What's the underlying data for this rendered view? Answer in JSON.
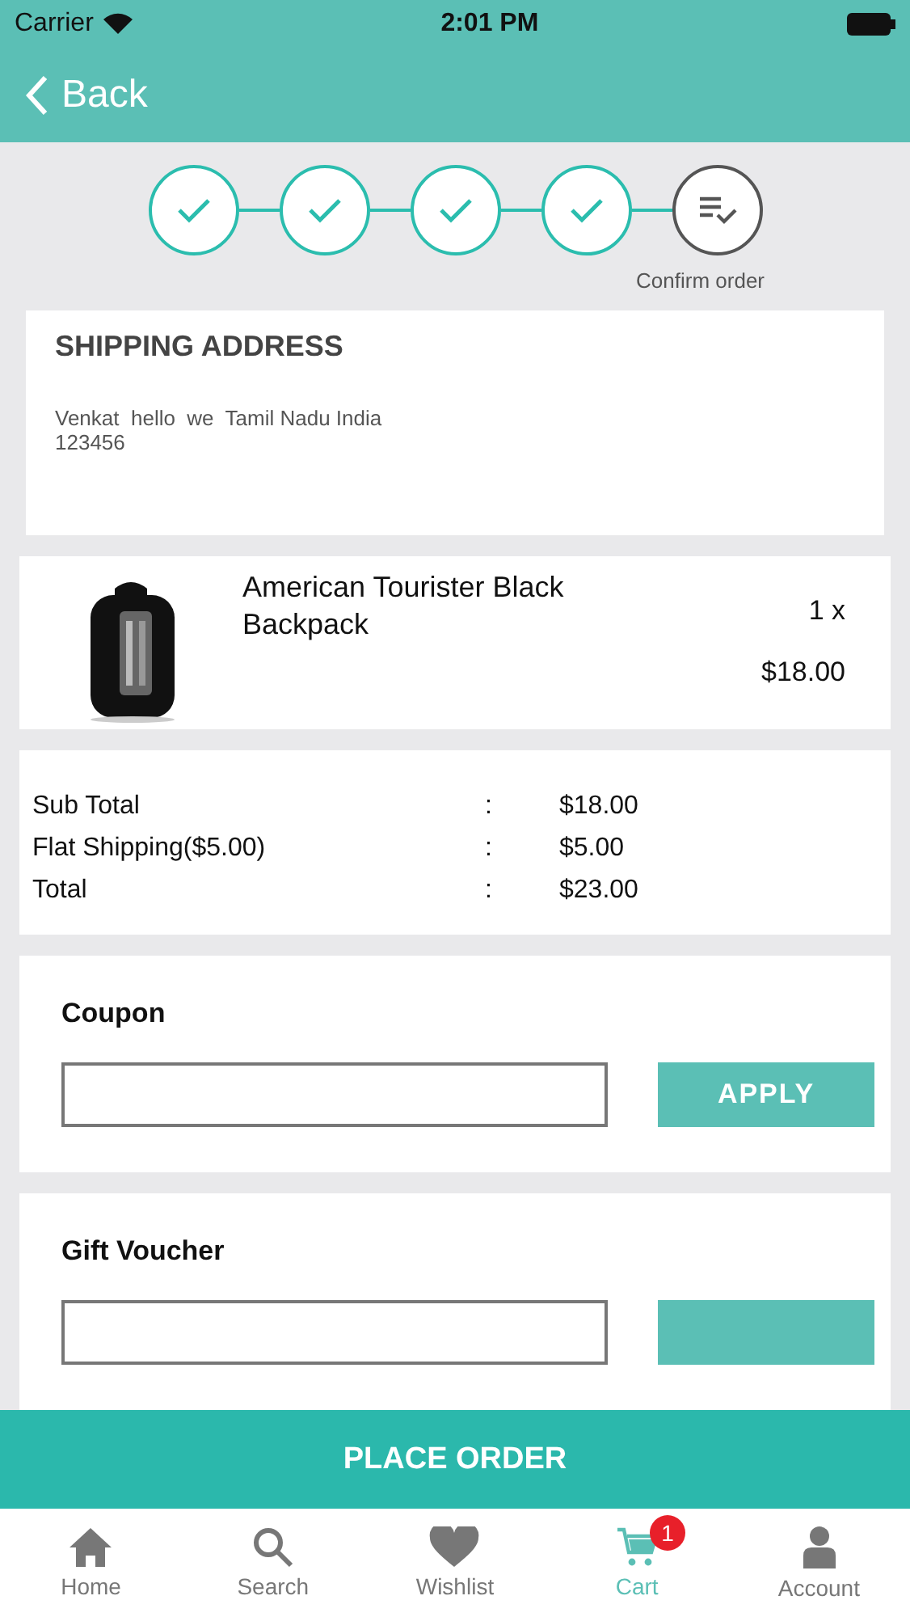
{
  "status_bar": {
    "carrier": "Carrier",
    "time": "2:01 PM"
  },
  "nav": {
    "back": "Back"
  },
  "steps": [
    {
      "done": true
    },
    {
      "done": true
    },
    {
      "done": true
    },
    {
      "done": true
    },
    {
      "done": false,
      "label": "Confirm order"
    }
  ],
  "shipping": {
    "title": "SHIPPING ADDRESS",
    "address": "Venkat  hello  we  Tamil Nadu India\n123456"
  },
  "item": {
    "name": "American Tourister Black Backpack",
    "qty": "1 x",
    "price": "$18.00"
  },
  "totals": [
    {
      "label": "Sub Total",
      "sep": ":",
      "value": "$18.00"
    },
    {
      "label": "Flat Shipping($5.00)",
      "sep": ":",
      "value": "$5.00"
    },
    {
      "label": "Total",
      "sep": ":",
      "value": "$23.00"
    }
  ],
  "forms": [
    {
      "title": "Coupon",
      "button": "APPLY"
    },
    {
      "title": "Gift Voucher"
    }
  ],
  "place_order": "PLACE ORDER",
  "tabs": [
    {
      "label": "Home",
      "kind": "home",
      "selected": false
    },
    {
      "label": "Search",
      "kind": "search",
      "selected": false
    },
    {
      "label": "Wishlist",
      "kind": "heart",
      "selected": false
    },
    {
      "label": "Cart",
      "kind": "cart",
      "selected": true,
      "badge": "1"
    },
    {
      "label": "Account",
      "kind": "user",
      "selected": false
    }
  ]
}
